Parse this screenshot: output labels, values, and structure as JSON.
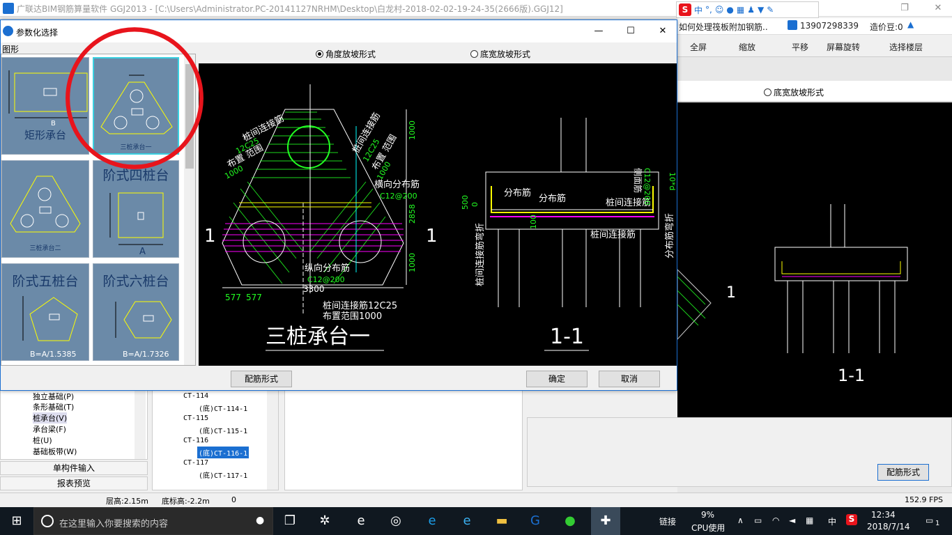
{
  "app": {
    "window_title": "广联达BIM钢筋算量软件 GGJ2013 - [C:\\Users\\Administrator.PC-20141127NRHM\\Desktop\\白龙村-2018-02-02-19-24-35(2666版).GGJ12]"
  },
  "ime_bar": {
    "items": [
      "中",
      "°,"
    ]
  },
  "right_bar": {
    "notice": "如何处理筏板附加钢筋..",
    "phone": "13907298339",
    "bean": "造价豆:0"
  },
  "toolbar": {
    "fullscreen": "全屏",
    "zoom": "缩放",
    "pan": "平移",
    "rotate": "屏幕旋转",
    "select_floor": "选择楼层"
  },
  "dialog": {
    "title": "参数化选择",
    "shape_label": "图形",
    "radio_angle": "角度放坡形式",
    "radio_width": "底宽放坡形式",
    "selected_radio": "angle",
    "rebar_button": "配筋形式",
    "ok_button": "确定",
    "cancel_button": "取消"
  },
  "thumbnails": [
    {
      "label": "矩形承台",
      "dim": "B"
    },
    {
      "label": "三桩承台一"
    },
    {
      "label": "三桩承台二"
    },
    {
      "label": "阶式四桩台",
      "dim": "A"
    },
    {
      "label": "阶式五桩台",
      "dim": "B=A/1.5385"
    },
    {
      "label": "阶式六桩台",
      "dim": "B=A/1.7326"
    }
  ],
  "drawing": {
    "title": "三桩承台一",
    "section_title": "1-1",
    "section_mark": "1",
    "labels": {
      "pile_link_top_left": "桩间连接筋",
      "pile_link_top_left_spec": "12C25",
      "layout_range": "布置 范围",
      "layout_range_val": "1000",
      "pile_link_top_right": "桩间连接筋",
      "pile_link_top_right_spec": "12C25",
      "layout_range_right": "布置 范围",
      "layout_range_right_val": "1000",
      "transverse": "横向分布筋",
      "transverse_spec": "C12@200",
      "longitudinal": "纵向分布筋",
      "longitudinal_spec": "C12@200",
      "pile_link_bottom": "桩间连接筋12C25",
      "pile_link_bottom_range": "布置范围1000",
      "dim_1000_a": "1000",
      "dim_2858": "2858",
      "dim_1000_b": "1000",
      "dim_3300": "3300",
      "dim_577a": "577",
      "dim_577b": "577",
      "sec_dist1": "分布筋",
      "sec_dist2": "分布筋",
      "sec_link": "桩间连接筋",
      "sec_link2": "桩间连接筋",
      "sec_side": "侧面筋",
      "sec_side_spec": "C12@200",
      "sec_dim_500": "500",
      "sec_dim_0": "0",
      "sec_dim_100": "100",
      "sec_10d": "10*d",
      "sec_bend_left": "桩间连接筋弯折",
      "sec_bend_right": "分布筋弯折"
    }
  },
  "tree_left": {
    "items": [
      "独立基础(P)",
      "条形基础(T)",
      "桩承台(V)",
      "承台梁(F)",
      "桩(U)",
      "基础板带(W)"
    ],
    "selected": "桩承台(V)"
  },
  "nav": {
    "single_input": "单构件输入",
    "report_preview": "报表预览"
  },
  "tree_mid": {
    "items": [
      "CT-114",
      "(底)CT-114-1",
      "CT-115",
      "(底)CT-115-1",
      "CT-116",
      "(底)CT-116-1",
      "CT-117",
      "(底)CT-117-1"
    ],
    "selected": "(底)CT-116-1"
  },
  "status": {
    "floor_height": "层高:2.15m",
    "base_elev": "底标高:-2.2m",
    "zero": "0",
    "fps": "152.9 FPS"
  },
  "taskbar": {
    "search_placeholder": "在这里输入你要搜索的内容",
    "link": "链接",
    "cpu_pct": "9%",
    "cpu_label": "CPU使用",
    "lang": "中",
    "time": "12:34",
    "date": "2018/7/14",
    "notif_count": "1"
  },
  "colors": {
    "accent": "#1b6fd1",
    "highlight": "#e8141c",
    "thumb_bg": "#6b8aa8"
  }
}
